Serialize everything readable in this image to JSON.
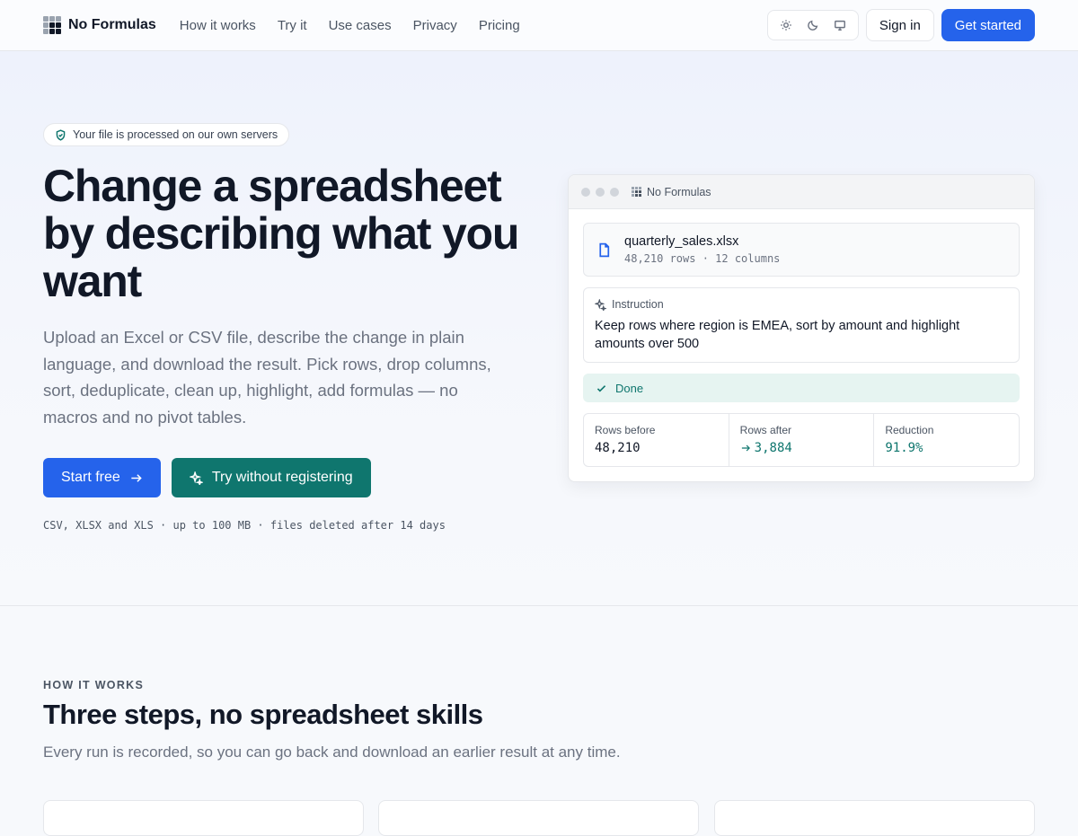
{
  "brand": {
    "name": "No Formulas"
  },
  "nav": {
    "links": [
      "How it works",
      "Try it",
      "Use cases",
      "Privacy",
      "Pricing"
    ],
    "theme_options": [
      "light",
      "dark",
      "system"
    ],
    "sign_in": "Sign in",
    "get_started": "Get started"
  },
  "hero": {
    "badge": "Your file is processed on our own servers",
    "title": "Change a spreadsheet by describing what you want",
    "subtitle": "Upload an Excel or CSV file, describe the change in plain language, and download the result. Pick rows, drop columns, sort, deduplicate, clean up, highlight, add formulas — no macros and no pivot tables.",
    "cta_primary": "Start free",
    "cta_secondary": "Try without registering",
    "fine_print": "CSV, XLSX and XLS · up to 100 MB · files deleted after 14 days"
  },
  "preview": {
    "window_title": "No Formulas",
    "file_name": "quarterly_sales.xlsx",
    "file_meta": "48,210 rows · 12 columns",
    "instruction_label": "Instruction",
    "instruction_text": "Keep rows where region is EMEA, sort by amount and highlight amounts over 500",
    "status": "Done",
    "stats": [
      {
        "label": "Rows before",
        "value": "48,210"
      },
      {
        "label": "Rows after",
        "value": "3,884"
      },
      {
        "label": "Reduction",
        "value": "91.9%"
      }
    ]
  },
  "how": {
    "kicker": "HOW IT WORKS",
    "title": "Three steps, no spreadsheet skills",
    "subtitle": "Every run is recorded, so you can go back and download an earlier result at any time."
  },
  "colors": {
    "primary": "#2563eb",
    "teal": "#0f766e",
    "text": "#111827",
    "muted": "#6b7280"
  }
}
